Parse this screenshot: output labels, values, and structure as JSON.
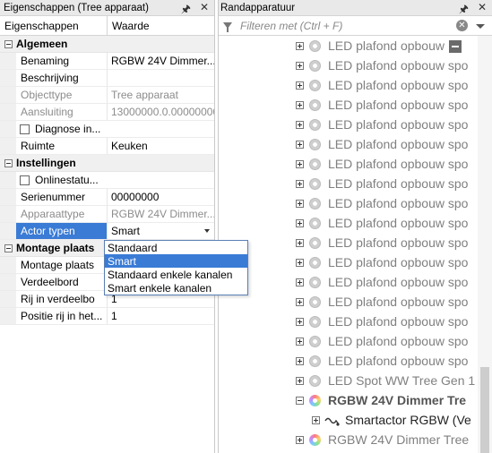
{
  "left_panel": {
    "title": "Eigenschappen (Tree apparaat)",
    "pin_icon": "pin-icon",
    "close_icon": "close-icon",
    "col_property": "Eigenschappen",
    "col_value": "Waarde",
    "cat_general": "Algemeen",
    "cat_settings": "Instellingen",
    "cat_mounting": "Montage plaats",
    "rows_general": [
      {
        "key": "Benaming",
        "value": "RGBW 24V Dimmer..."
      },
      {
        "key": "Beschrijving",
        "value": ""
      },
      {
        "key": "Objecttype",
        "value": "Tree apparaat"
      },
      {
        "key": "Aansluiting",
        "value": "13000000.0.00000000"
      },
      {
        "key": "Diagnose in...",
        "value": ""
      },
      {
        "key": "Ruimte",
        "value": "Keuken"
      }
    ],
    "rows_settings": [
      {
        "key": "Onlinestatu...",
        "value": ""
      },
      {
        "key": "Serienummer",
        "value": "00000000"
      },
      {
        "key": "Apparaattype",
        "value": "RGBW 24V Dimmer..."
      },
      {
        "key": "Actor typen",
        "value": "Smart"
      }
    ],
    "rows_mounting": [
      {
        "key": "Montage plaats",
        "value": ""
      },
      {
        "key": "Verdeelbord",
        "value": ""
      },
      {
        "key": "Rij in verdeelbo",
        "value": "1"
      },
      {
        "key": "Positie rij in het...",
        "value": "1"
      }
    ],
    "actor_options": [
      "Standaard",
      "Smart",
      "Standaard enkele kanalen",
      "Smart enkele kanalen"
    ],
    "actor_selected": "Smart"
  },
  "right_panel": {
    "title": "Randapparatuur",
    "pin_icon": "pin-icon",
    "close_icon": "close-icon",
    "filter_placeholder": "Filteren met (Ctrl + F)",
    "tree_items": [
      {
        "label": "LED plafond opbouw",
        "icon": "lamp-icon"
      },
      {
        "label": "LED plafond opbouw spo",
        "icon": "lamp-icon"
      },
      {
        "label": "LED plafond opbouw spo",
        "icon": "lamp-icon"
      },
      {
        "label": "LED plafond opbouw spo",
        "icon": "lamp-icon"
      },
      {
        "label": "LED plafond opbouw spo",
        "icon": "lamp-icon"
      },
      {
        "label": "LED plafond opbouw spo",
        "icon": "lamp-icon"
      },
      {
        "label": "LED plafond opbouw spo",
        "icon": "lamp-icon"
      },
      {
        "label": "LED plafond opbouw spo",
        "icon": "lamp-icon"
      },
      {
        "label": "LED plafond opbouw spo",
        "icon": "lamp-icon"
      },
      {
        "label": "LED plafond opbouw spo",
        "icon": "lamp-icon"
      },
      {
        "label": "LED plafond opbouw spo",
        "icon": "lamp-icon"
      },
      {
        "label": "LED plafond opbouw spo",
        "icon": "lamp-icon"
      },
      {
        "label": "LED plafond opbouw spo",
        "icon": "lamp-icon"
      },
      {
        "label": "LED plafond opbouw spo",
        "icon": "lamp-icon"
      },
      {
        "label": "LED plafond opbouw spo",
        "icon": "lamp-icon"
      },
      {
        "label": "LED plafond opbouw spo",
        "icon": "lamp-icon"
      },
      {
        "label": "LED plafond opbouw spo",
        "icon": "lamp-icon"
      },
      {
        "label": "LED Spot WW Tree Gen 1",
        "icon": "lamp-icon"
      },
      {
        "label": "RGBW 24V Dimmer Tre",
        "icon": "rgb-icon"
      },
      {
        "label": "Smartactor RGBW (Ve",
        "icon": "actor-icon"
      },
      {
        "label": "RGBW 24V Dimmer Tree",
        "icon": "rgb-icon"
      }
    ]
  }
}
